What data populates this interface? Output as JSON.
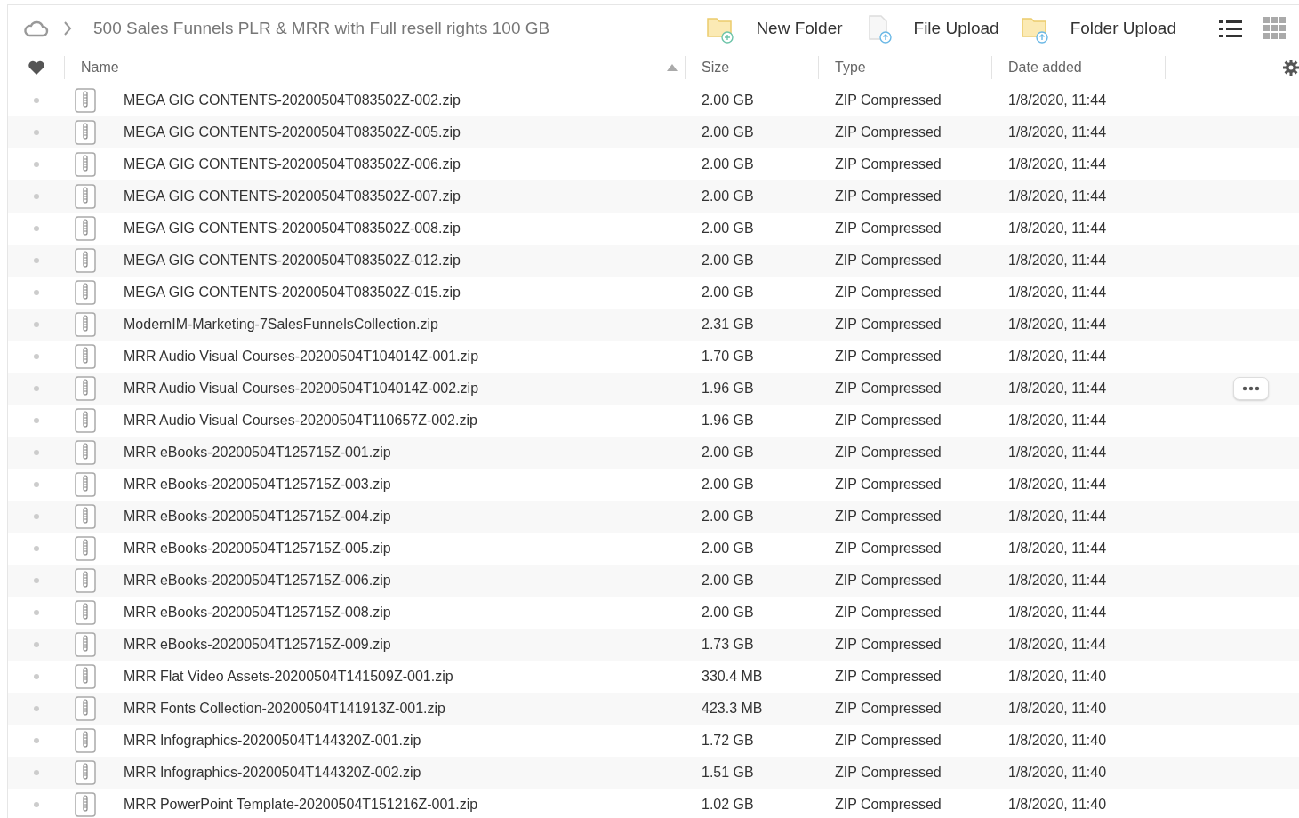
{
  "breadcrumb": {
    "title": "500 Sales Funnels PLR & MRR with Full resell rights 100 GB"
  },
  "toolbar": [
    {
      "kind": "new-folder",
      "label": "New Folder"
    },
    {
      "kind": "file-upload",
      "label": "File Upload"
    },
    {
      "kind": "folder-upload",
      "label": "Folder Upload"
    }
  ],
  "view_modes": [
    {
      "kind": "list",
      "selected": true
    },
    {
      "kind": "grid",
      "selected": false
    }
  ],
  "table": {
    "columns": [
      {
        "label": "Name",
        "sorted": true
      },
      {
        "label": "Size",
        "sorted": false
      },
      {
        "label": "Type",
        "sorted": false
      },
      {
        "label": "Date added",
        "sorted": false
      }
    ],
    "rows": [
      {
        "name": "MEGA GIG CONTENTS-20200504T083502Z-002.zip",
        "size": "2.00 GB",
        "type": "ZIP Compressed",
        "date": "1/8/2020, 11:44",
        "menu_button": false
      },
      {
        "name": "MEGA GIG CONTENTS-20200504T083502Z-005.zip",
        "size": "2.00 GB",
        "type": "ZIP Compressed",
        "date": "1/8/2020, 11:44",
        "menu_button": false
      },
      {
        "name": "MEGA GIG CONTENTS-20200504T083502Z-006.zip",
        "size": "2.00 GB",
        "type": "ZIP Compressed",
        "date": "1/8/2020, 11:44",
        "menu_button": false
      },
      {
        "name": "MEGA GIG CONTENTS-20200504T083502Z-007.zip",
        "size": "2.00 GB",
        "type": "ZIP Compressed",
        "date": "1/8/2020, 11:44",
        "menu_button": false
      },
      {
        "name": "MEGA GIG CONTENTS-20200504T083502Z-008.zip",
        "size": "2.00 GB",
        "type": "ZIP Compressed",
        "date": "1/8/2020, 11:44",
        "menu_button": false
      },
      {
        "name": "MEGA GIG CONTENTS-20200504T083502Z-012.zip",
        "size": "2.00 GB",
        "type": "ZIP Compressed",
        "date": "1/8/2020, 11:44",
        "menu_button": false
      },
      {
        "name": "MEGA GIG CONTENTS-20200504T083502Z-015.zip",
        "size": "2.00 GB",
        "type": "ZIP Compressed",
        "date": "1/8/2020, 11:44",
        "menu_button": false
      },
      {
        "name": "ModernIM-Marketing-7SalesFunnelsCollection.zip",
        "size": "2.31 GB",
        "type": "ZIP Compressed",
        "date": "1/8/2020, 11:44",
        "menu_button": false
      },
      {
        "name": "MRR Audio Visual Courses-20200504T104014Z-001.zip",
        "size": "1.70 GB",
        "type": "ZIP Compressed",
        "date": "1/8/2020, 11:44",
        "menu_button": false
      },
      {
        "name": "MRR Audio Visual Courses-20200504T104014Z-002.zip",
        "size": "1.96 GB",
        "type": "ZIP Compressed",
        "date": "1/8/2020, 11:44",
        "menu_button": true
      },
      {
        "name": "MRR Audio Visual Courses-20200504T110657Z-002.zip",
        "size": "1.96 GB",
        "type": "ZIP Compressed",
        "date": "1/8/2020, 11:44",
        "menu_button": false
      },
      {
        "name": "MRR eBooks-20200504T125715Z-001.zip",
        "size": "2.00 GB",
        "type": "ZIP Compressed",
        "date": "1/8/2020, 11:44",
        "menu_button": false
      },
      {
        "name": "MRR eBooks-20200504T125715Z-003.zip",
        "size": "2.00 GB",
        "type": "ZIP Compressed",
        "date": "1/8/2020, 11:44",
        "menu_button": false
      },
      {
        "name": "MRR eBooks-20200504T125715Z-004.zip",
        "size": "2.00 GB",
        "type": "ZIP Compressed",
        "date": "1/8/2020, 11:44",
        "menu_button": false
      },
      {
        "name": "MRR eBooks-20200504T125715Z-005.zip",
        "size": "2.00 GB",
        "type": "ZIP Compressed",
        "date": "1/8/2020, 11:44",
        "menu_button": false
      },
      {
        "name": "MRR eBooks-20200504T125715Z-006.zip",
        "size": "2.00 GB",
        "type": "ZIP Compressed",
        "date": "1/8/2020, 11:44",
        "menu_button": false
      },
      {
        "name": "MRR eBooks-20200504T125715Z-008.zip",
        "size": "2.00 GB",
        "type": "ZIP Compressed",
        "date": "1/8/2020, 11:44",
        "menu_button": false
      },
      {
        "name": "MRR eBooks-20200504T125715Z-009.zip",
        "size": "1.73 GB",
        "type": "ZIP Compressed",
        "date": "1/8/2020, 11:44",
        "menu_button": false
      },
      {
        "name": "MRR Flat Video Assets-20200504T141509Z-001.zip",
        "size": "330.4 MB",
        "type": "ZIP Compressed",
        "date": "1/8/2020, 11:40",
        "menu_button": false
      },
      {
        "name": "MRR Fonts Collection-20200504T141913Z-001.zip",
        "size": "423.3 MB",
        "type": "ZIP Compressed",
        "date": "1/8/2020, 11:40",
        "menu_button": false
      },
      {
        "name": "MRR Infographics-20200504T144320Z-001.zip",
        "size": "1.72 GB",
        "type": "ZIP Compressed",
        "date": "1/8/2020, 11:40",
        "menu_button": false
      },
      {
        "name": "MRR Infographics-20200504T144320Z-002.zip",
        "size": "1.51 GB",
        "type": "ZIP Compressed",
        "date": "1/8/2020, 11:40",
        "menu_button": false
      },
      {
        "name": "MRR PowerPoint Template-20200504T151216Z-001.zip",
        "size": "1.02 GB",
        "type": "ZIP Compressed",
        "date": "1/8/2020, 11:40",
        "menu_button": false
      }
    ]
  }
}
